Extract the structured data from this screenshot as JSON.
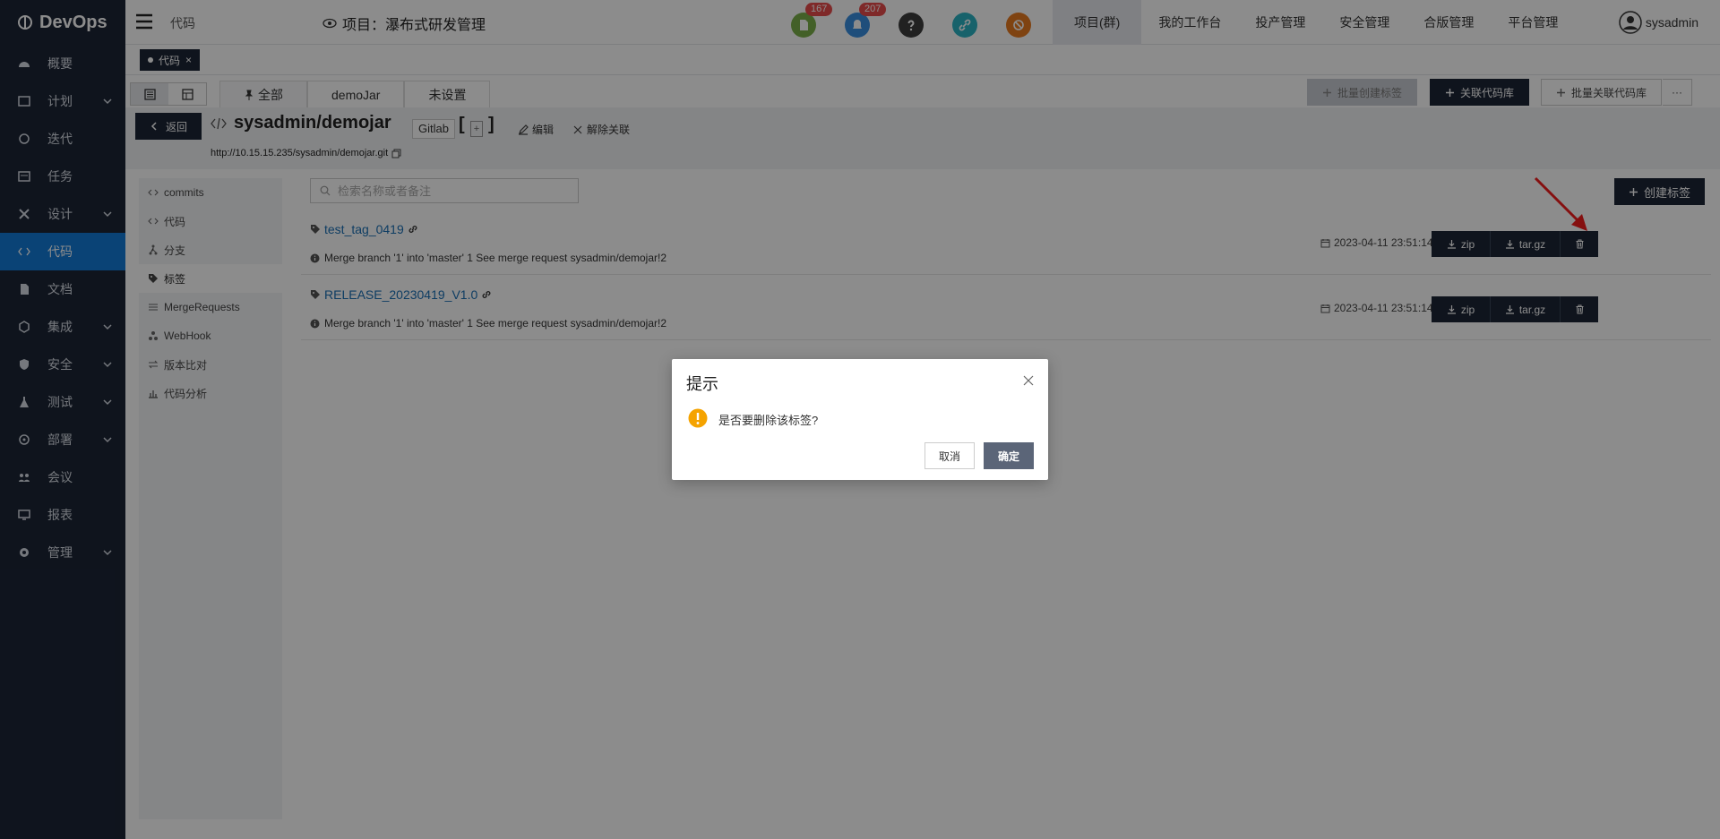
{
  "brand": {
    "name": "DevOps"
  },
  "sidebar": {
    "items": [
      {
        "label": "概要",
        "expandable": false
      },
      {
        "label": "计划",
        "expandable": true
      },
      {
        "label": "迭代",
        "expandable": false
      },
      {
        "label": "任务",
        "expandable": false
      },
      {
        "label": "设计",
        "expandable": true
      },
      {
        "label": "代码",
        "expandable": false,
        "active": true
      },
      {
        "label": "文档",
        "expandable": false
      },
      {
        "label": "集成",
        "expandable": true
      },
      {
        "label": "安全",
        "expandable": true
      },
      {
        "label": "测试",
        "expandable": true
      },
      {
        "label": "部署",
        "expandable": true
      },
      {
        "label": "会议",
        "expandable": false
      },
      {
        "label": "报表",
        "expandable": false
      },
      {
        "label": "管理",
        "expandable": true
      }
    ]
  },
  "header": {
    "crumb": "代码",
    "project": "项目：瀑布式研发管理",
    "badges": {
      "docs": "167",
      "notifications": "207"
    },
    "nav": [
      "项目(群)",
      "我的工作台",
      "投产管理",
      "安全管理",
      "合版管理",
      "平台管理"
    ],
    "user": "sysadmin"
  },
  "open_tab": {
    "label": "代码",
    "close": "×"
  },
  "view_tabs": [
    "全部",
    "demoJar",
    "未设置"
  ],
  "toolbar": {
    "batch_create_tag": "批量创建标签",
    "link_repo": "关联代码库",
    "batch_link_repo": "批量关联代码库",
    "more": "···"
  },
  "repo": {
    "back": "返回",
    "name": "sysadmin/demojar",
    "type": "Gitlab",
    "plus": "+",
    "edit": "编辑",
    "unlink": "解除关联",
    "url": "http://10.15.15.235/sysadmin/demojar.git"
  },
  "left_menu": [
    "commits",
    "代码",
    "分支",
    "标签",
    "MergeRequests",
    "WebHook",
    "版本比对",
    "代码分析"
  ],
  "search": {
    "placeholder": "检索名称或者备注"
  },
  "create_tag": "创建标签",
  "tags": [
    {
      "name": "test_tag_0419",
      "message": "Merge branch '1' into 'master' 1 See merge request sysadmin/demojar!2",
      "date": "2023-04-11 23:51:14"
    },
    {
      "name": "RELEASE_20230419_V1.0",
      "message": "Merge branch '1' into 'master' 1 See merge request sysadmin/demojar!2",
      "date": "2023-04-11 23:51:14"
    }
  ],
  "tag_buttons": {
    "zip": "zip",
    "targz": "tar.gz"
  },
  "dialog": {
    "title": "提示",
    "message": "是否要删除该标签?",
    "cancel": "取消",
    "confirm": "确定"
  },
  "colors": {
    "sidebar": "#1c2536",
    "active": "#137ad8",
    "link": "#1a6fb5",
    "warning": "#f5a300",
    "badge": "#e84b4b"
  }
}
